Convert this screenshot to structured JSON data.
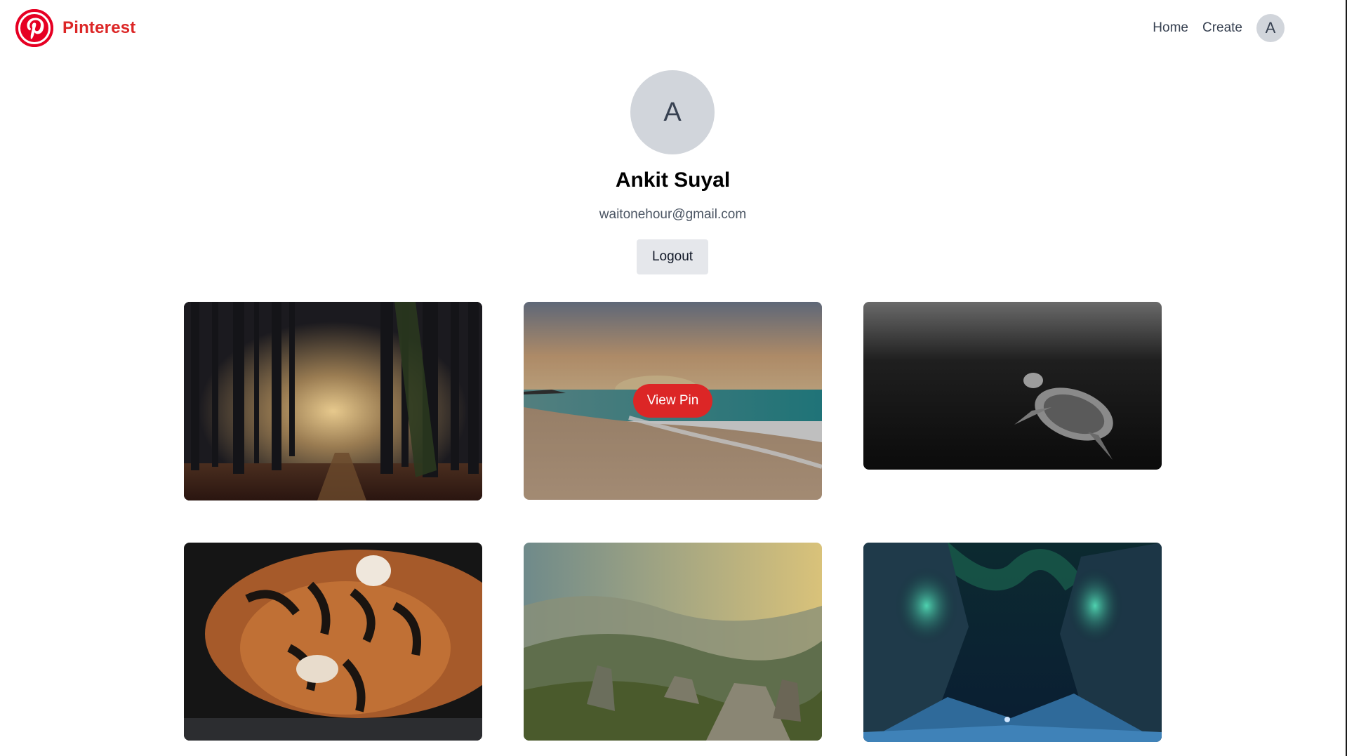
{
  "header": {
    "brand": "Pinterest",
    "nav": {
      "home": "Home",
      "create": "Create",
      "avatar_initial": "A"
    }
  },
  "profile": {
    "avatar_initial": "A",
    "name": "Ankit Suyal",
    "email": "waitonehour@gmail.com",
    "logout_label": "Logout"
  },
  "pins": [
    {
      "subject": "misty forest path",
      "hovered": false
    },
    {
      "subject": "beach sunset with waves",
      "hovered": true,
      "action_label": "View Pin"
    },
    {
      "subject": "sea turtle underwater (black and white)",
      "hovered": false
    },
    {
      "subject": "resting tiger",
      "hovered": false
    },
    {
      "subject": "mountain valley with rocks",
      "hovered": false
    },
    {
      "subject": "aurora over icy canyon",
      "hovered": false
    }
  ],
  "colors": {
    "brand_red": "#dc2626",
    "avatar_gray": "#d1d5db",
    "button_gray": "#e5e7eb",
    "nav_text": "#374151"
  }
}
